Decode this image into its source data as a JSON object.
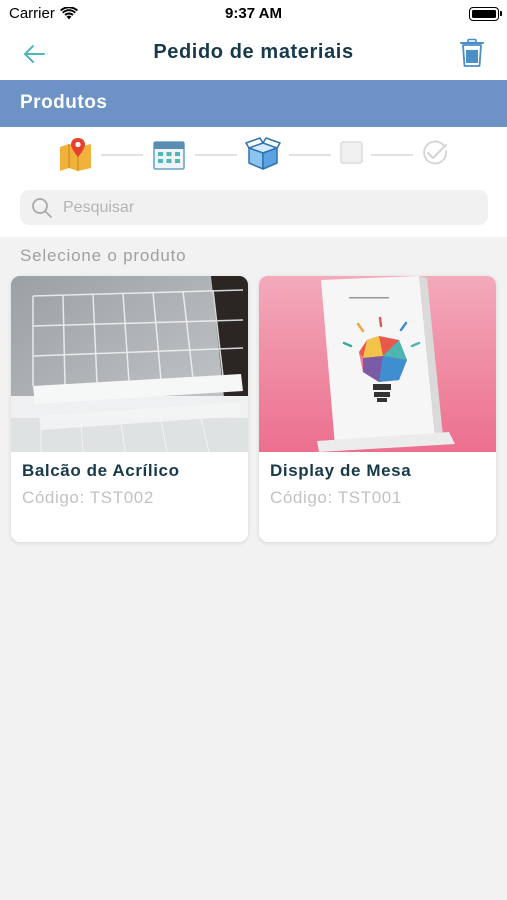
{
  "status_bar": {
    "carrier": "Carrier",
    "time": "9:37 AM"
  },
  "nav": {
    "title": "Pedido de materiais"
  },
  "section": {
    "title": "Produtos"
  },
  "stepper": {
    "steps": [
      {
        "name": "map-pin-icon",
        "state": "done"
      },
      {
        "name": "calendar-icon",
        "state": "done"
      },
      {
        "name": "box-icon",
        "state": "active"
      },
      {
        "name": "square-icon",
        "state": "pending"
      },
      {
        "name": "check-circle-icon",
        "state": "pending"
      }
    ]
  },
  "search": {
    "placeholder": "Pesquisar",
    "value": ""
  },
  "list": {
    "label": "Selecione o produto"
  },
  "products": [
    {
      "title": "Balcão de Acrílico",
      "code": "Código: TST002"
    },
    {
      "title": "Display de Mesa",
      "code": "Código: TST001"
    }
  ],
  "colors": {
    "accent": "#6d93c6",
    "title_text": "#173a4b",
    "back_arrow": "#4fb7b9",
    "trash_icon": "#4a8fc5"
  }
}
